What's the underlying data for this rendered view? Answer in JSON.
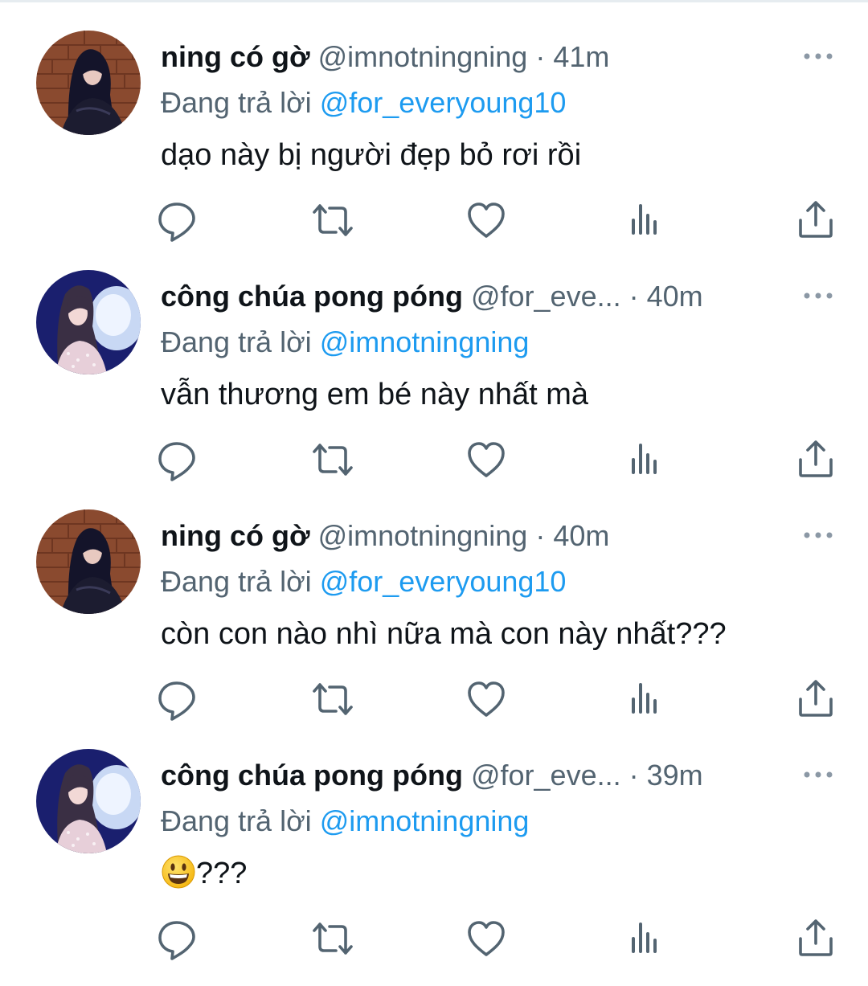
{
  "tweets": [
    {
      "display_name": "ning có gờ",
      "handle": "@imnotningning",
      "separator": "·",
      "time": "41m",
      "reply_prefix": "Đang trả lời",
      "reply_to": "@for_everyoung10",
      "text": "dạo này bị người đẹp bỏ rơi rồi",
      "avatar": "avatar-ning"
    },
    {
      "display_name": "công chúa pong póng",
      "handle": "@for_eve...",
      "separator": "·",
      "time": "40m",
      "reply_prefix": "Đang trả lời",
      "reply_to": "@imnotningning",
      "text": "vẫn thương em bé này nhất mà",
      "avatar": "avatar-pongpong"
    },
    {
      "display_name": "ning có gờ",
      "handle": "@imnotningning",
      "separator": "·",
      "time": "40m",
      "reply_prefix": "Đang trả lời",
      "reply_to": "@for_everyoung10",
      "text": "còn con nào nhì nữa mà con này nhất???",
      "avatar": "avatar-ning"
    },
    {
      "display_name": "công chúa pong póng",
      "handle": "@for_eve...",
      "separator": "·",
      "time": "39m",
      "reply_prefix": "Đang trả lời",
      "reply_to": "@imnotningning",
      "text": "???",
      "text_emoji": "grinning-face-emoji",
      "avatar": "avatar-pongpong"
    }
  ],
  "icons": {
    "reply": "reply-icon",
    "retweet": "retweet-icon",
    "like": "like-icon",
    "views": "views-icon",
    "share": "share-icon",
    "more": "more-icon"
  },
  "colors": {
    "text": "#0f1419",
    "secondary": "#536471",
    "mention": "#1d9bf0"
  }
}
